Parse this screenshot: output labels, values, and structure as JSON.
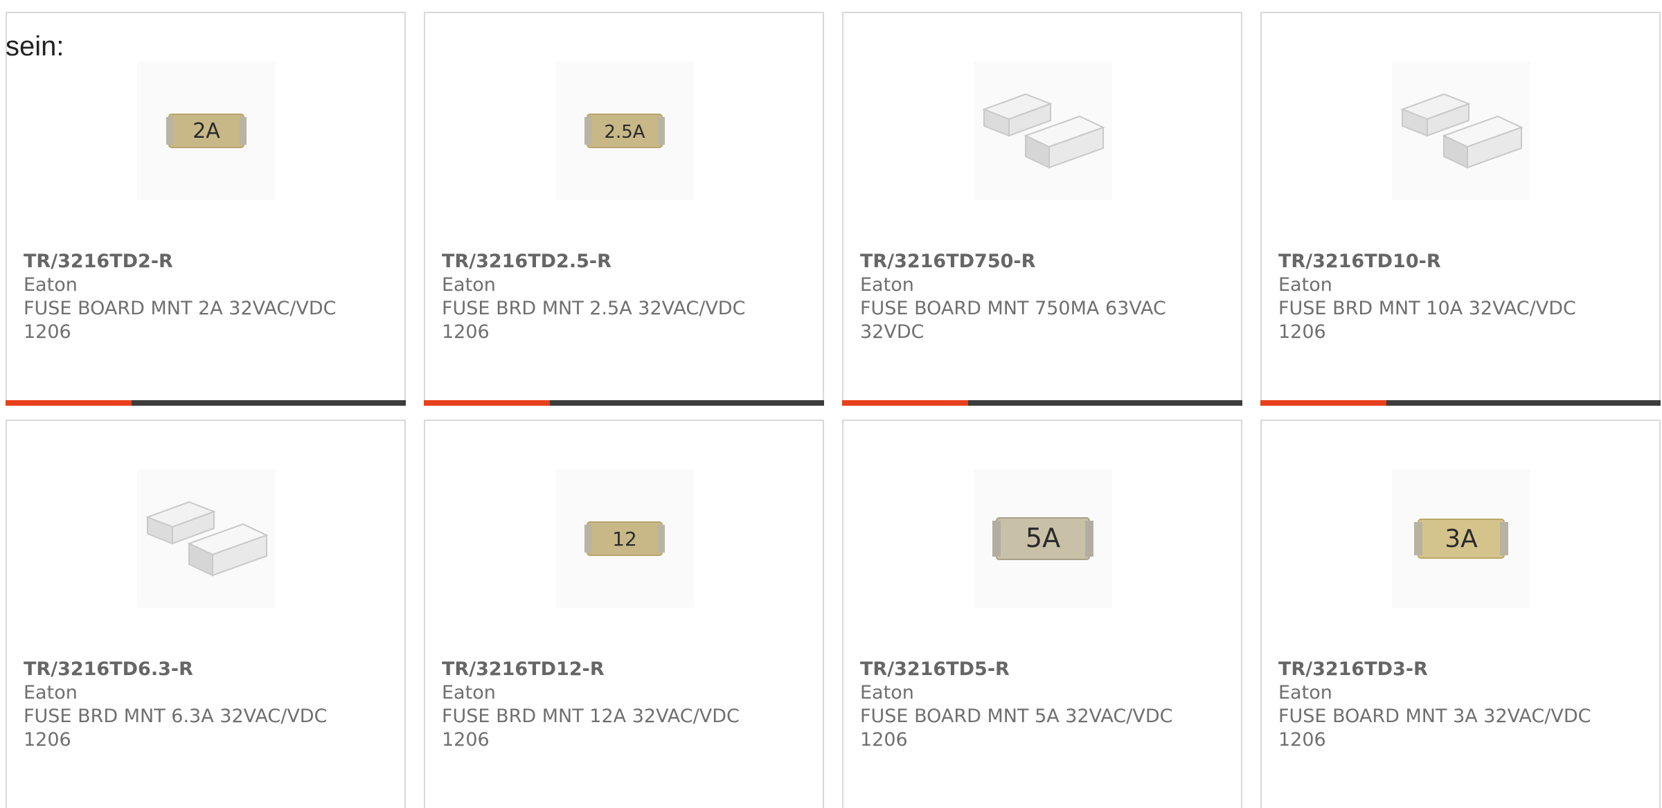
{
  "intro": {
    "text": "sein:"
  },
  "colors": {
    "accent": "#e8401c",
    "bar_dark": "#3c3c3c",
    "card_border": "#d9d9d9",
    "text_gray": "#6f6f6f",
    "label_tan": "#c8b888",
    "label_text": "#2a2a2a",
    "ceramic_light": "#e9e9e9",
    "ceramic_dark": "#cfcfcf"
  },
  "products": [
    {
      "part_number": "TR/3216TD2-R",
      "manufacturer": "Eaton",
      "description": "FUSE BOARD MNT 2A 32VAC/VDC 1206",
      "image_icon": "smd-fuse-labeled-icon",
      "marking": "2A"
    },
    {
      "part_number": "TR/3216TD2.5-R",
      "manufacturer": "Eaton",
      "description": "FUSE BRD MNT 2.5A 32VAC/VDC 1206",
      "image_icon": "smd-fuse-labeled-icon",
      "marking": "2.5A"
    },
    {
      "part_number": "TR/3216TD750-R",
      "manufacturer": "Eaton",
      "description": "FUSE BOARD MNT 750MA 63VAC 32VDC",
      "image_icon": "ceramic-fuse-pair-icon",
      "marking": ""
    },
    {
      "part_number": "TR/3216TD10-R",
      "manufacturer": "Eaton",
      "description": "FUSE BRD MNT 10A 32VAC/VDC 1206",
      "image_icon": "ceramic-fuse-pair-icon",
      "marking": ""
    },
    {
      "part_number": "TR/3216TD6.3-R",
      "manufacturer": "Eaton",
      "description": "FUSE BRD MNT 6.3A 32VAC/VDC 1206",
      "image_icon": "ceramic-fuse-pair-icon",
      "marking": ""
    },
    {
      "part_number": "TR/3216TD12-R",
      "manufacturer": "Eaton",
      "description": "FUSE BRD MNT 12A 32VAC/VDC 1206",
      "image_icon": "smd-fuse-labeled-icon",
      "marking": "12"
    },
    {
      "part_number": "TR/3216TD5-R",
      "manufacturer": "Eaton",
      "description": "FUSE BOARD MNT 5A 32VAC/VDC 1206",
      "image_icon": "smd-fuse-labeled-icon",
      "marking": "5A"
    },
    {
      "part_number": "TR/3216TD3-R",
      "manufacturer": "Eaton",
      "description": "FUSE BOARD MNT 3A 32VAC/VDC 1206",
      "image_icon": "smd-fuse-labeled-icon",
      "marking": "3A"
    }
  ]
}
